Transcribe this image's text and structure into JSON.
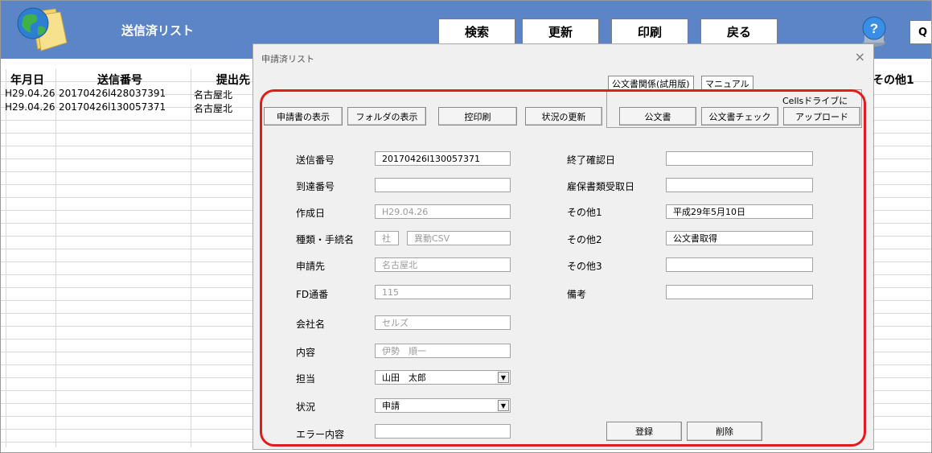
{
  "header": {
    "title": "送信済リスト",
    "buttons": {
      "search": "検索",
      "refresh": "更新",
      "print": "印刷",
      "back": "戻る",
      "q": "Q"
    }
  },
  "grid": {
    "columns": {
      "date": "年月日",
      "send_no": "送信番号",
      "dest": "提出先",
      "other1": "その他1"
    },
    "rows": [
      {
        "date": "H29.04.26",
        "send_no": "20170426l428037391",
        "dest": "名古屋北"
      },
      {
        "date": "H29.04.26",
        "send_no": "20170426l130057371",
        "dest": "名古屋北"
      }
    ]
  },
  "dialog": {
    "title": "申請済リスト",
    "close": "×",
    "tabs": {
      "official": "公文書関係(試用版)",
      "manual": "マニュアル"
    },
    "cells_note": "Cellsドライブに",
    "buttons": {
      "show_application": "申請書の表示",
      "show_folder": "フォルダの表示",
      "copy_print": "控印刷",
      "status_update": "状況の更新",
      "official_doc": "公文書",
      "official_check": "公文書チェック",
      "upload": "アップロード",
      "register": "登録",
      "delete": "削除"
    },
    "labels": {
      "send_no": "送信番号",
      "arrival_no": "到達番号",
      "created": "作成日",
      "type": "種類・手続名",
      "dest": "申請先",
      "fd_no": "FD通番",
      "company": "会社名",
      "content": "内容",
      "person": "担当",
      "status": "状況",
      "error": "エラー内容",
      "end_date": "終了確認日",
      "employ_doc_date": "雇保書類受取日",
      "other1": "その他1",
      "other2": "その他2",
      "other3": "その他3",
      "remarks": "備考"
    },
    "values": {
      "send_no": "20170426l130057371",
      "arrival_no": "",
      "created": "H29.04.26",
      "type_code": "社",
      "type_name": "異動CSV",
      "dest": "名古屋北",
      "fd_no": "115",
      "company": "セルズ",
      "content": "伊勢　順一",
      "person": "山田　太郎",
      "status": "申請",
      "error": "",
      "end_date": "",
      "employ_doc_date": "",
      "other1": "平成29年5月10日",
      "other2": "公文書取得",
      "other3": "",
      "remarks": ""
    }
  }
}
